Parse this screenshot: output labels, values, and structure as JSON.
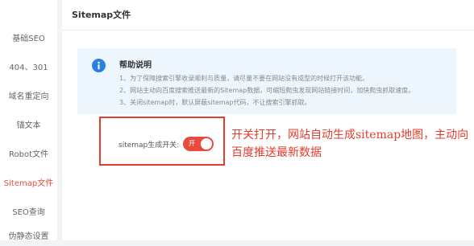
{
  "sidebar": {
    "items": [
      {
        "label": "基础SEO",
        "active": false
      },
      {
        "label": "404、301",
        "active": false
      },
      {
        "label": "域名重定向",
        "active": false
      },
      {
        "label": "锚文本",
        "active": false
      },
      {
        "label": "Robot文件",
        "active": false
      },
      {
        "label": "Sitemap文件",
        "active": true
      },
      {
        "label": "SEO查询",
        "active": false
      },
      {
        "label": "伪静态设置",
        "active": false
      }
    ]
  },
  "header": {
    "title": "Sitemap文件"
  },
  "help": {
    "title": "帮助说明",
    "lines": [
      "1、为了保障搜索引擎收录顺利与质量，请尽量不要在网站没有成型的时候打开该功能。",
      "2、网站主动向百度搜索推送最新的Sitemap数据，可缩短爬虫发现网站链接时间，加快爬虫抓取速度。",
      "3、关闭sitemap时，默认屏蔽sitemap代码，不让搜索引擎抓取。"
    ]
  },
  "toggle": {
    "label": "sitemap生成开关:",
    "state_text": "开",
    "on": true
  },
  "annotation": {
    "text": "开关打开，网站自动生成sitemap地图，主动向百度推送最新数据"
  },
  "colors": {
    "accent": "#e84b3c",
    "annotation": "#e53b2c",
    "info_icon": "#2a7de1",
    "help_bg": "#eef6fd"
  }
}
